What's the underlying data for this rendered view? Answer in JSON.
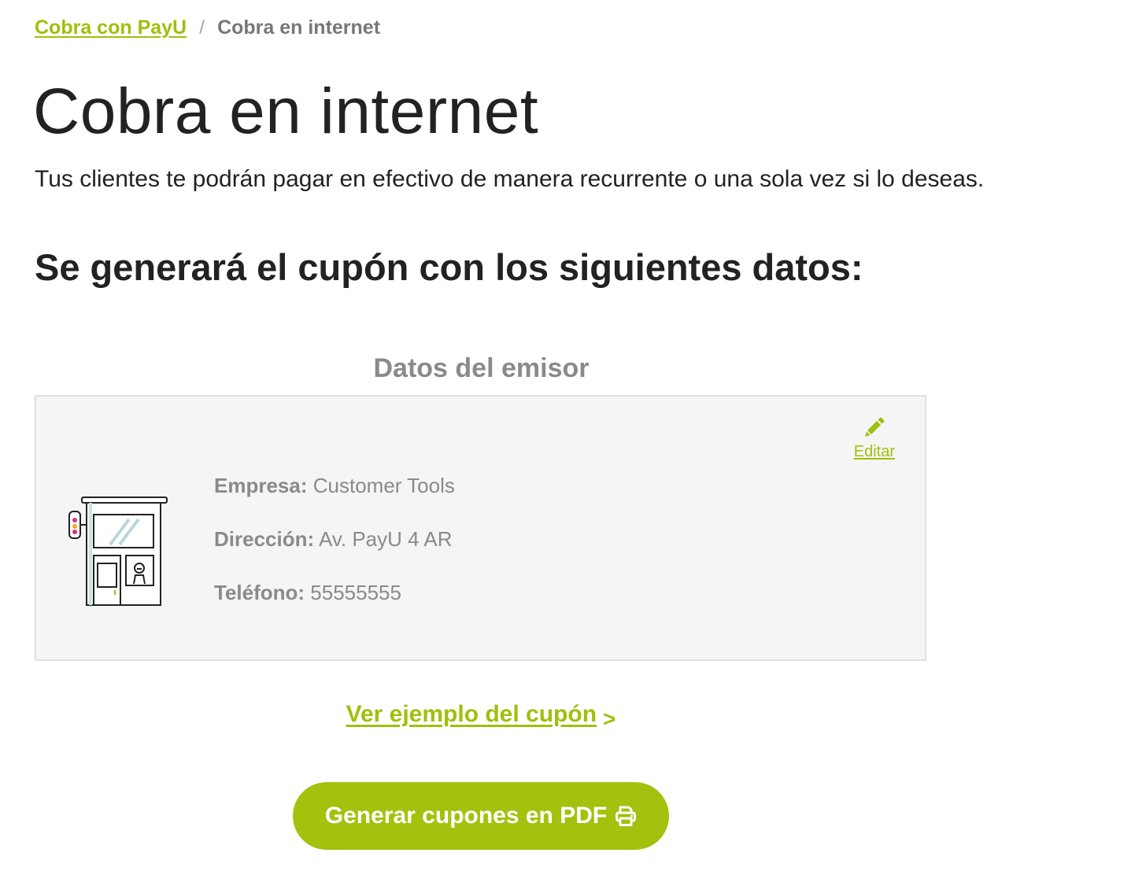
{
  "breadcrumb": {
    "parent_label": "Cobra con PayU",
    "separator": "/",
    "current_label": "Cobra en internet"
  },
  "page": {
    "title": "Cobra en internet",
    "subtitle": "Tus clientes te podrán pagar en efectivo de manera recurrente o una sola vez si lo deseas.",
    "section_heading": "Se generará el cupón con los siguientes datos:"
  },
  "issuer_card": {
    "title": "Datos del emisor",
    "edit_label": "Editar",
    "edit_icon": "pencil-icon",
    "illustration": "kiosk-booth-illustration",
    "fields": [
      {
        "label": "Empresa:",
        "value": "Customer Tools"
      },
      {
        "label": "Dirección:",
        "value": "Av. PayU 4 AR"
      },
      {
        "label": "Teléfono:",
        "value": "55555555"
      }
    ]
  },
  "example_link": {
    "label": "Ver ejemplo del cupón",
    "chevron": ">"
  },
  "generate_button": {
    "label": "Generar cupones en PDF",
    "icon": "printer-icon"
  },
  "colors": {
    "brand_green": "#a2c20d",
    "link_green": "#9ec00c",
    "muted_text": "#8a8a8a",
    "card_background": "#f5f5f5"
  }
}
